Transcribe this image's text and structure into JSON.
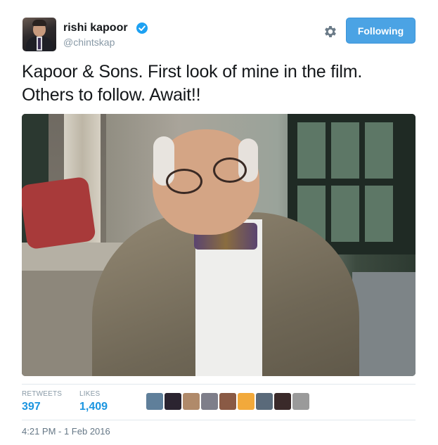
{
  "user": {
    "name": "rishi kapoor",
    "handle": "@chintskap",
    "verified": true
  },
  "follow_button": {
    "label": "Following",
    "color": "#4ba3e4"
  },
  "tweet": {
    "text_line1": "Kapoor & Sons. First look of mine in the film.",
    "text_line2": "Others to follow. Await!!"
  },
  "stats": {
    "retweets_label": "RETWEETS",
    "retweets_value": "397",
    "likes_label": "LIKES",
    "likes_value": "1,409"
  },
  "likers": [
    {
      "color": "#5f7f9a"
    },
    {
      "color": "#2b2430"
    },
    {
      "color": "#b08a6a"
    },
    {
      "color": "#7e7e8a"
    },
    {
      "color": "#8a5a45"
    },
    {
      "color": "#f2a93b"
    },
    {
      "color": "#5a6a7a"
    },
    {
      "color": "#3a2a2a"
    },
    {
      "color": "#9a9a9a"
    }
  ],
  "timestamp": "4:21 PM - 1 Feb 2016",
  "colors": {
    "accent": "#1b95e0",
    "verified": "#1da1f2",
    "muted": "#8899a6"
  },
  "icons": {
    "settings": "gear-icon",
    "verified": "verified-badge-icon"
  }
}
